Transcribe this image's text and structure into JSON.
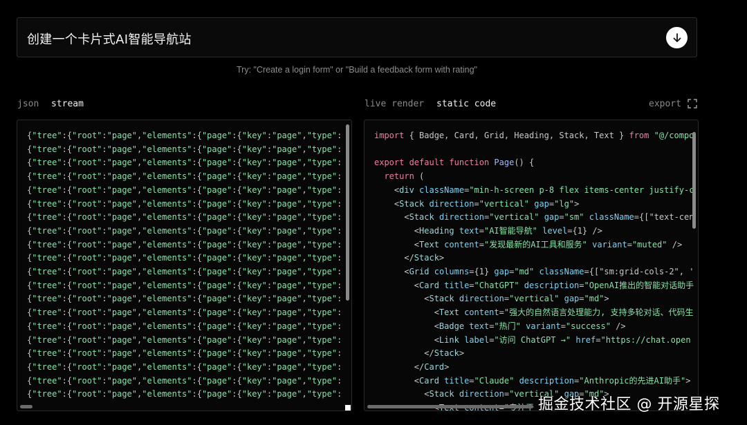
{
  "prompt": {
    "value": "创建一个卡片式AI智能导航站",
    "submit_icon": "arrow-down-icon"
  },
  "hint": "Try: \"Create a login form\" or \"Build a feedback form with rating\"",
  "left_tabs": [
    "json",
    "stream"
  ],
  "right_tabs": [
    "live render",
    "static code"
  ],
  "export_label": "export",
  "expand_icon": "expand-icon",
  "json_line": [
    {
      "c": "p",
      "t": "{"
    },
    {
      "c": "s",
      "t": "\"tree\""
    },
    {
      "c": "p",
      "t": ":{"
    },
    {
      "c": "s",
      "t": "\"root\""
    },
    {
      "c": "p",
      "t": ":"
    },
    {
      "c": "s",
      "t": "\"page\""
    },
    {
      "c": "p",
      "t": ","
    },
    {
      "c": "s",
      "t": "\"elements\""
    },
    {
      "c": "p",
      "t": ":{"
    },
    {
      "c": "s",
      "t": "\"page\""
    },
    {
      "c": "p",
      "t": ":{"
    },
    {
      "c": "s",
      "t": "\"key\""
    },
    {
      "c": "p",
      "t": ":"
    },
    {
      "c": "s",
      "t": "\"page\""
    },
    {
      "c": "p",
      "t": ","
    },
    {
      "c": "s",
      "t": "\"type\""
    },
    {
      "c": "p",
      "t": ":"
    }
  ],
  "json_line_count": 20,
  "code_lines": [
    [
      {
        "c": "k",
        "t": "import"
      },
      {
        "c": "p",
        "t": " { Badge, Card, Grid, Heading, Stack, Text } "
      },
      {
        "c": "k",
        "t": "from"
      },
      {
        "c": "p",
        "t": " "
      },
      {
        "c": "s",
        "t": "\"@/compo"
      }
    ],
    [],
    [
      {
        "c": "k",
        "t": "export default function"
      },
      {
        "c": "p",
        "t": " "
      },
      {
        "c": "f",
        "t": "Page"
      },
      {
        "c": "p",
        "t": "() {"
      }
    ],
    [
      {
        "c": "p",
        "t": "  "
      },
      {
        "c": "k",
        "t": "return"
      },
      {
        "c": "p",
        "t": " ("
      }
    ],
    [
      {
        "c": "p",
        "t": "    <"
      },
      {
        "c": "t",
        "t": "div"
      },
      {
        "c": "p",
        "t": " "
      },
      {
        "c": "a",
        "t": "className"
      },
      {
        "c": "p",
        "t": "="
      },
      {
        "c": "s",
        "t": "\"min-h-screen p-8 flex items-center justify-c"
      }
    ],
    [
      {
        "c": "p",
        "t": "    <"
      },
      {
        "c": "t",
        "t": "Stack"
      },
      {
        "c": "p",
        "t": " "
      },
      {
        "c": "a",
        "t": "direction"
      },
      {
        "c": "p",
        "t": "="
      },
      {
        "c": "s",
        "t": "\"vertical\""
      },
      {
        "c": "p",
        "t": " "
      },
      {
        "c": "a",
        "t": "gap"
      },
      {
        "c": "p",
        "t": "="
      },
      {
        "c": "s",
        "t": "\"lg\""
      },
      {
        "c": "p",
        "t": ">"
      }
    ],
    [
      {
        "c": "p",
        "t": "      <"
      },
      {
        "c": "t",
        "t": "Stack"
      },
      {
        "c": "p",
        "t": " "
      },
      {
        "c": "a",
        "t": "direction"
      },
      {
        "c": "p",
        "t": "="
      },
      {
        "c": "s",
        "t": "\"vertical\""
      },
      {
        "c": "p",
        "t": " "
      },
      {
        "c": "a",
        "t": "gap"
      },
      {
        "c": "p",
        "t": "="
      },
      {
        "c": "s",
        "t": "\"sm\""
      },
      {
        "c": "p",
        "t": " "
      },
      {
        "c": "a",
        "t": "className"
      },
      {
        "c": "p",
        "t": "={[\"text-cen"
      }
    ],
    [
      {
        "c": "p",
        "t": "        <"
      },
      {
        "c": "t",
        "t": "Heading"
      },
      {
        "c": "p",
        "t": " "
      },
      {
        "c": "a",
        "t": "text"
      },
      {
        "c": "p",
        "t": "="
      },
      {
        "c": "s",
        "t": "\"AI智能导航\""
      },
      {
        "c": "p",
        "t": " "
      },
      {
        "c": "a",
        "t": "level"
      },
      {
        "c": "p",
        "t": "={1} />"
      }
    ],
    [
      {
        "c": "p",
        "t": "        <"
      },
      {
        "c": "t",
        "t": "Text"
      },
      {
        "c": "p",
        "t": " "
      },
      {
        "c": "a",
        "t": "content"
      },
      {
        "c": "p",
        "t": "="
      },
      {
        "c": "s",
        "t": "\"发现最新的AI工具和服务\""
      },
      {
        "c": "p",
        "t": " "
      },
      {
        "c": "a",
        "t": "variant"
      },
      {
        "c": "p",
        "t": "="
      },
      {
        "c": "s",
        "t": "\"muted\""
      },
      {
        "c": "p",
        "t": " />"
      }
    ],
    [
      {
        "c": "p",
        "t": "      </"
      },
      {
        "c": "t",
        "t": "Stack"
      },
      {
        "c": "p",
        "t": ">"
      }
    ],
    [
      {
        "c": "p",
        "t": "      <"
      },
      {
        "c": "t",
        "t": "Grid"
      },
      {
        "c": "p",
        "t": " "
      },
      {
        "c": "a",
        "t": "columns"
      },
      {
        "c": "p",
        "t": "={1} "
      },
      {
        "c": "a",
        "t": "gap"
      },
      {
        "c": "p",
        "t": "="
      },
      {
        "c": "s",
        "t": "\"md\""
      },
      {
        "c": "p",
        "t": " "
      },
      {
        "c": "a",
        "t": "className"
      },
      {
        "c": "p",
        "t": "={[\"sm:grid-cols-2\", '"
      }
    ],
    [
      {
        "c": "p",
        "t": "        <"
      },
      {
        "c": "t",
        "t": "Card"
      },
      {
        "c": "p",
        "t": " "
      },
      {
        "c": "a",
        "t": "title"
      },
      {
        "c": "p",
        "t": "="
      },
      {
        "c": "s",
        "t": "\"ChatGPT\""
      },
      {
        "c": "p",
        "t": " "
      },
      {
        "c": "a",
        "t": "description"
      },
      {
        "c": "p",
        "t": "="
      },
      {
        "c": "s",
        "t": "\"OpenAI推出的智能对话助手"
      }
    ],
    [
      {
        "c": "p",
        "t": "          <"
      },
      {
        "c": "t",
        "t": "Stack"
      },
      {
        "c": "p",
        "t": " "
      },
      {
        "c": "a",
        "t": "direction"
      },
      {
        "c": "p",
        "t": "="
      },
      {
        "c": "s",
        "t": "\"vertical\""
      },
      {
        "c": "p",
        "t": " "
      },
      {
        "c": "a",
        "t": "gap"
      },
      {
        "c": "p",
        "t": "="
      },
      {
        "c": "s",
        "t": "\"md\""
      },
      {
        "c": "p",
        "t": ">"
      }
    ],
    [
      {
        "c": "p",
        "t": "            <"
      },
      {
        "c": "t",
        "t": "Text"
      },
      {
        "c": "p",
        "t": " "
      },
      {
        "c": "a",
        "t": "content"
      },
      {
        "c": "p",
        "t": "="
      },
      {
        "c": "s",
        "t": "\"强大的自然语言处理能力, 支持多轮对话、代码生"
      }
    ],
    [
      {
        "c": "p",
        "t": "            <"
      },
      {
        "c": "t",
        "t": "Badge"
      },
      {
        "c": "p",
        "t": " "
      },
      {
        "c": "a",
        "t": "text"
      },
      {
        "c": "p",
        "t": "="
      },
      {
        "c": "s",
        "t": "\"热门\""
      },
      {
        "c": "p",
        "t": " "
      },
      {
        "c": "a",
        "t": "variant"
      },
      {
        "c": "p",
        "t": "="
      },
      {
        "c": "s",
        "t": "\"success\""
      },
      {
        "c": "p",
        "t": " />"
      }
    ],
    [
      {
        "c": "p",
        "t": "            <"
      },
      {
        "c": "t",
        "t": "Link"
      },
      {
        "c": "p",
        "t": " "
      },
      {
        "c": "a",
        "t": "label"
      },
      {
        "c": "p",
        "t": "="
      },
      {
        "c": "s",
        "t": "\"访问 ChatGPT →\""
      },
      {
        "c": "p",
        "t": " "
      },
      {
        "c": "a",
        "t": "href"
      },
      {
        "c": "p",
        "t": "="
      },
      {
        "c": "s",
        "t": "\"https://chat.open"
      }
    ],
    [
      {
        "c": "p",
        "t": "          </"
      },
      {
        "c": "t",
        "t": "Stack"
      },
      {
        "c": "p",
        "t": ">"
      }
    ],
    [
      {
        "c": "p",
        "t": "        </"
      },
      {
        "c": "t",
        "t": "Card"
      },
      {
        "c": "p",
        "t": ">"
      }
    ],
    [
      {
        "c": "p",
        "t": "        <"
      },
      {
        "c": "t",
        "t": "Card"
      },
      {
        "c": "p",
        "t": " "
      },
      {
        "c": "a",
        "t": "title"
      },
      {
        "c": "p",
        "t": "="
      },
      {
        "c": "s",
        "t": "\"Claude\""
      },
      {
        "c": "p",
        "t": " "
      },
      {
        "c": "a",
        "t": "description"
      },
      {
        "c": "p",
        "t": "="
      },
      {
        "c": "s",
        "t": "\"Anthropic的先进AI助手\""
      },
      {
        "c": "p",
        "t": ">"
      }
    ],
    [
      {
        "c": "p",
        "t": "          <"
      },
      {
        "c": "t",
        "t": "Stack"
      },
      {
        "c": "p",
        "t": " "
      },
      {
        "c": "a",
        "t": "direction"
      },
      {
        "c": "p",
        "t": "="
      },
      {
        "c": "s",
        "t": "\"vertical\""
      },
      {
        "c": "p",
        "t": " "
      },
      {
        "c": "a",
        "t": "gap"
      },
      {
        "c": "p",
        "t": "="
      },
      {
        "c": "s",
        "t": "\"md\""
      },
      {
        "c": "p",
        "t": ">"
      }
    ],
    [
      {
        "c": "p",
        "t": "            <"
      },
      {
        "c": "t",
        "t": "Text"
      },
      {
        "c": "p",
        "t": " "
      },
      {
        "c": "a",
        "t": "content"
      },
      {
        "c": "p",
        "t": "="
      },
      {
        "c": "s",
        "t": "\"专注于"
      }
    ]
  ],
  "watermark": "掘金技术社区 @ 开源星探"
}
